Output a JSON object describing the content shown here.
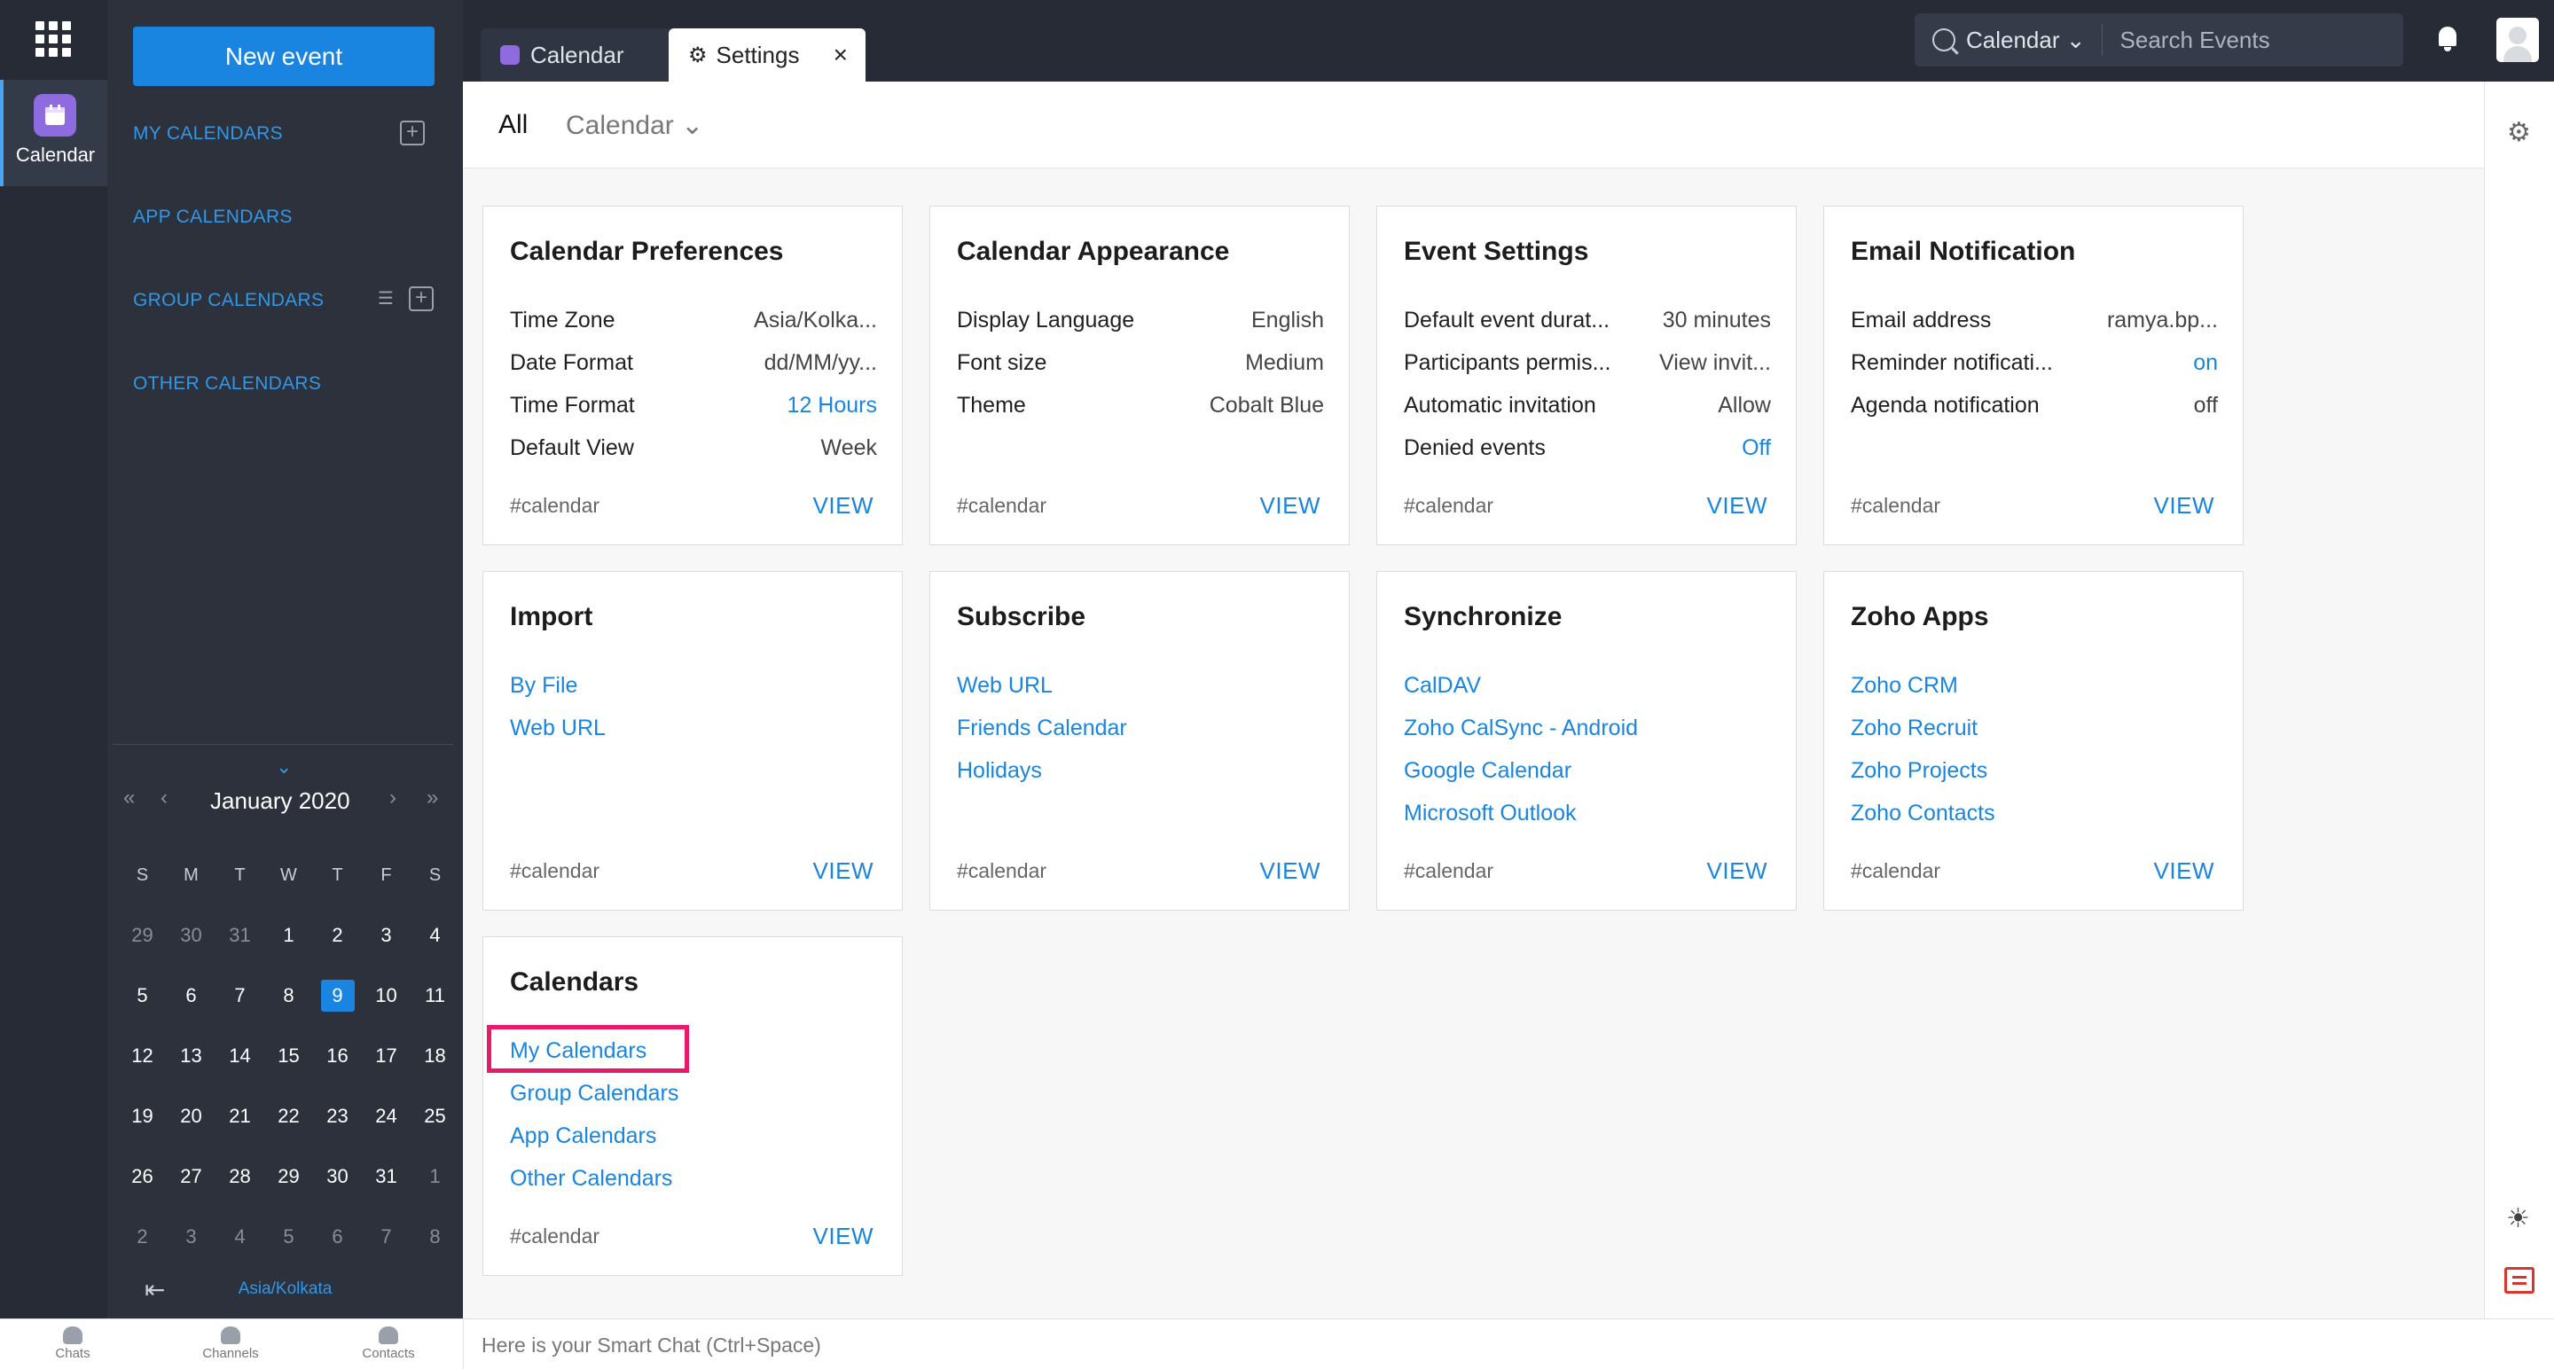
{
  "rail": {
    "app_label": "Calendar"
  },
  "sidebar": {
    "new_event_label": "New event",
    "sections": [
      "MY CALENDARS",
      "APP CALENDARS",
      "GROUP CALENDARS",
      "OTHER CALENDARS"
    ],
    "mini_calendar": {
      "month_label": "January 2020",
      "weekdays": [
        "S",
        "M",
        "T",
        "W",
        "T",
        "F",
        "S"
      ],
      "weeks": [
        [
          "29",
          "30",
          "31",
          "1",
          "2",
          "3",
          "4"
        ],
        [
          "5",
          "6",
          "7",
          "8",
          "9",
          "10",
          "11"
        ],
        [
          "12",
          "13",
          "14",
          "15",
          "16",
          "17",
          "18"
        ],
        [
          "19",
          "20",
          "21",
          "22",
          "23",
          "24",
          "25"
        ],
        [
          "26",
          "27",
          "28",
          "29",
          "30",
          "31",
          "1"
        ],
        [
          "2",
          "3",
          "4",
          "5",
          "6",
          "7",
          "8"
        ]
      ],
      "today": "9",
      "timezone": "Asia/Kolkata"
    }
  },
  "topbar": {
    "tabs": [
      {
        "label": "Calendar"
      },
      {
        "label": "Settings"
      }
    ],
    "search_scope": "Calendar",
    "search_placeholder": "Search Events"
  },
  "subnav": {
    "all_label": "All",
    "calendar_label": "Calendar"
  },
  "cards": [
    {
      "title": "Calendar Preferences",
      "rows": [
        {
          "k": "Time Zone",
          "v": "Asia/Kolka..."
        },
        {
          "k": "Date Format",
          "v": "dd/MM/yy..."
        },
        {
          "k": "Time Format",
          "v": "12 Hours",
          "blue": true
        },
        {
          "k": "Default View",
          "v": "Week"
        }
      ],
      "tag": "#calendar",
      "view": "VIEW"
    },
    {
      "title": "Calendar Appearance",
      "rows": [
        {
          "k": "Display Language",
          "v": "English"
        },
        {
          "k": "Font size",
          "v": "Medium"
        },
        {
          "k": "Theme",
          "v": "Cobalt Blue"
        }
      ],
      "tag": "#calendar",
      "view": "VIEW"
    },
    {
      "title": "Event Settings",
      "rows": [
        {
          "k": "Default event durat...",
          "v": "30 minutes"
        },
        {
          "k": "Participants permis...",
          "v": "View invit..."
        },
        {
          "k": "Automatic invitation",
          "v": "Allow"
        },
        {
          "k": "Denied events",
          "v": "Off",
          "blue": true
        }
      ],
      "tag": "#calendar",
      "view": "VIEW"
    },
    {
      "title": "Email Notification",
      "rows": [
        {
          "k": "Email address",
          "v": "ramya.bp..."
        },
        {
          "k": "Reminder notificati...",
          "v": "on",
          "blue": true
        },
        {
          "k": "Agenda notification",
          "v": "off"
        }
      ],
      "tag": "#calendar",
      "view": "VIEW"
    },
    {
      "title": "Import",
      "links": [
        "By File",
        "Web URL"
      ],
      "tag": "#calendar",
      "view": "VIEW"
    },
    {
      "title": "Subscribe",
      "links": [
        "Web URL",
        "Friends Calendar",
        "Holidays"
      ],
      "tag": "#calendar",
      "view": "VIEW"
    },
    {
      "title": "Synchronize",
      "links": [
        "CalDAV",
        "Zoho CalSync - Android",
        "Google Calendar",
        "Microsoft Outlook"
      ],
      "tag": "#calendar",
      "view": "VIEW"
    },
    {
      "title": "Zoho Apps",
      "links": [
        "Zoho CRM",
        "Zoho Recruit",
        "Zoho Projects",
        "Zoho Contacts"
      ],
      "tag": "#calendar",
      "view": "VIEW"
    },
    {
      "title": "Calendars",
      "links": [
        "My Calendars",
        "Group Calendars",
        "App Calendars",
        "Other Calendars"
      ],
      "tag": "#calendar",
      "view": "VIEW",
      "highlight_link": 0
    }
  ],
  "bottombar": {
    "items": [
      "Chats",
      "Channels",
      "Contacts"
    ],
    "smart_chat_placeholder": "Here is your Smart Chat (Ctrl+Space)"
  },
  "colors": {
    "accent": "#1a85e0",
    "highlight": "#ea1a6a",
    "rail": "#262b35",
    "sidebar": "#2c313c"
  }
}
